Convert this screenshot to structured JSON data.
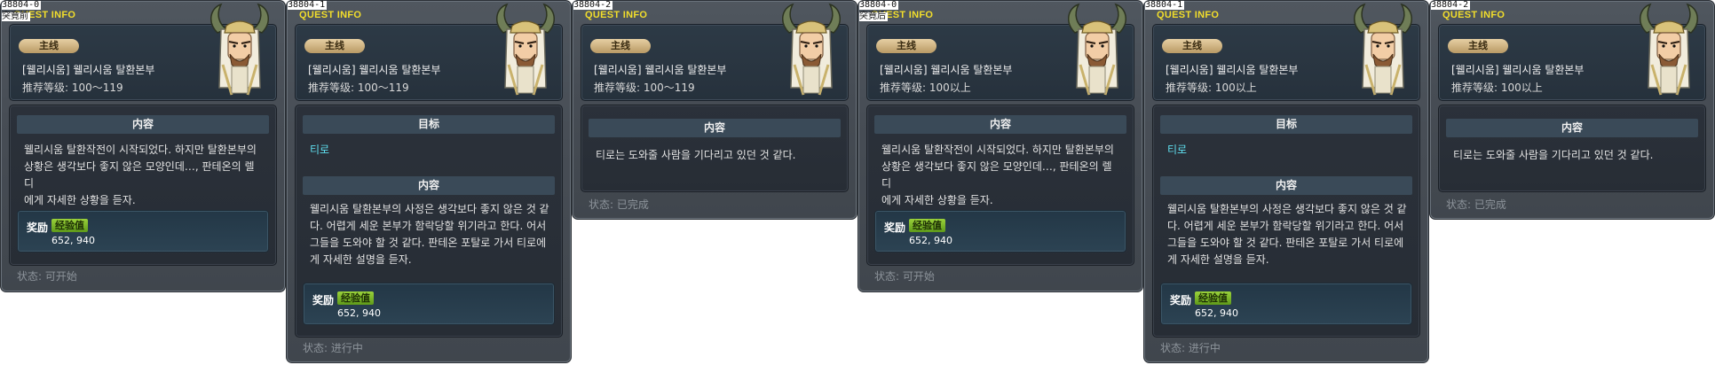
{
  "header_title": "QUEST INFO",
  "state_marks": {
    "before": "突竟前",
    "after": "突竟后"
  },
  "labels": {
    "content": "内容",
    "target": "目标",
    "reward": "奖励",
    "exp": "经验值"
  },
  "quest": {
    "badge": "主线",
    "name": "[웰리시움] 웰리시움 탈환본부",
    "level_a": "推荐等级: 100～119",
    "level_b": "推荐等级: 100以上"
  },
  "texts": {
    "desc_start": "웰리시움 탈환작전이 시작되었다. 하지만 탈환본부의\n상황은 생각보다 좋지 않은 모양인데…, 판테온의 렐디\n에게 자세한 상황을 듣자.",
    "desc_progress": "웰리시움 탈환본부의 사정은 생각보다 좋지 않은 것 같\n다. 어렵게 세운 본부가 함락당할 위기라고 한다. 어서\n그들을 도와야 할 것 같다. 판테온 포탈로 가서 티로에\n게 자세한 설명을 듣자.",
    "desc_done": "티로는 도와줄 사람을 기다리고 있던 것 같다.",
    "target_npc": "티로",
    "reward_value": "652, 940"
  },
  "status": {
    "available": "状态:  可开始",
    "in_progress": "状态:  进行中",
    "completed": "状态:  已完成"
  },
  "panels": [
    {
      "id": "38804-0",
      "mark": "突竟前",
      "level": "推荐等级: 100～119",
      "status": "状态:  可开始"
    },
    {
      "id": "38804-1",
      "mark": "",
      "level": "推荐等级: 100～119",
      "status": "状态:  进行中"
    },
    {
      "id": "38804-2",
      "mark": "",
      "level": "推荐等级: 100～119",
      "status": "状态:  已完成"
    },
    {
      "id": "38804-0",
      "mark": "突竟后",
      "level": "推荐等级: 100以上",
      "status": "状态:  可开始"
    },
    {
      "id": "38804-1",
      "mark": "",
      "level": "推荐等级: 100以上",
      "status": "状态:  进行中"
    },
    {
      "id": "38804-2",
      "mark": "",
      "level": "推荐等级: 100以上",
      "status": "状态:  已完成"
    }
  ],
  "colors": {
    "title": "#f2de2b",
    "target": "#5fe0f0",
    "exp_tag": "#8fc832",
    "badge": "#d6bb88"
  },
  "icons": {
    "npc": "npc-portrait-horned-elder"
  }
}
